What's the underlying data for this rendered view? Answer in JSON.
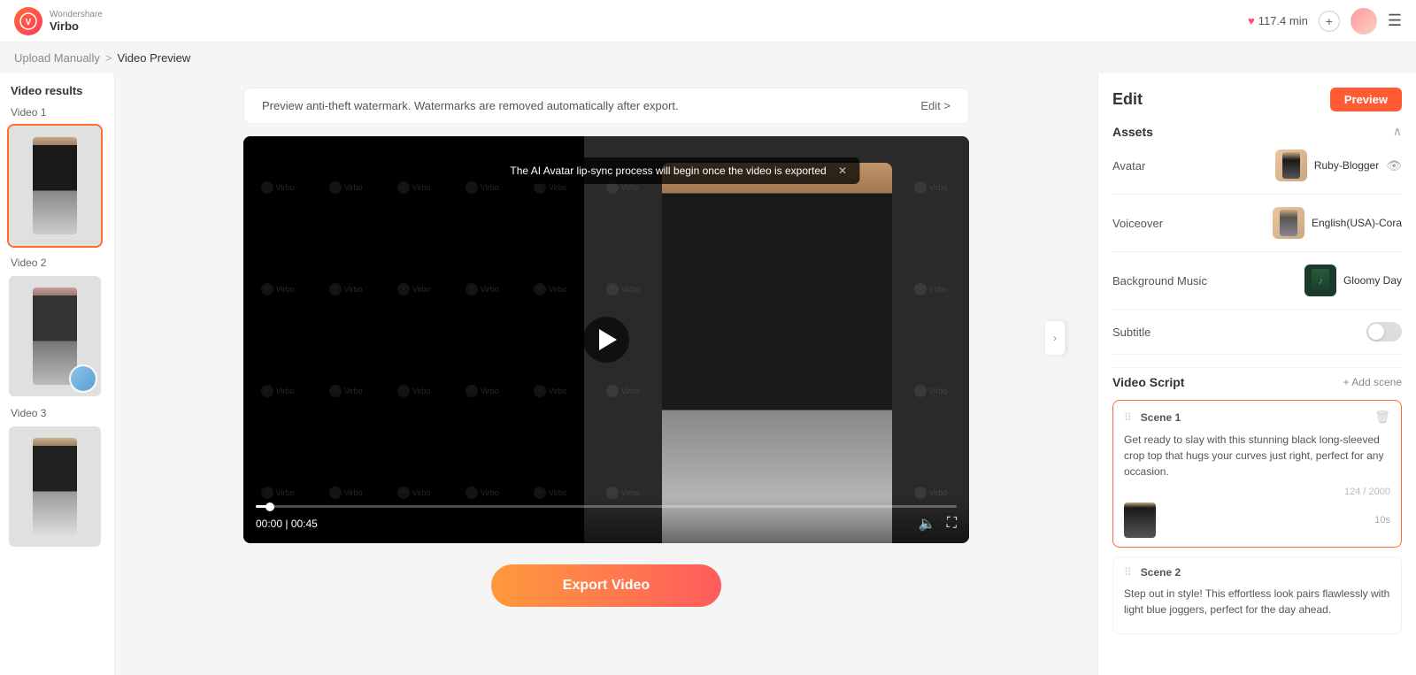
{
  "app": {
    "logo_letter": "V",
    "logo_name": "Wondershare",
    "app_name": "Virbo"
  },
  "topbar": {
    "credits": "117.4 min",
    "add_label": "+",
    "menu_icon": "☰"
  },
  "breadcrumb": {
    "upload": "Upload Manually",
    "separator": ">",
    "current": "Video Preview"
  },
  "sidebar": {
    "title": "Video results",
    "videos": [
      {
        "label": "Video 1",
        "id": "v1",
        "active": true
      },
      {
        "label": "Video 2",
        "id": "v2",
        "active": false
      },
      {
        "label": "Video 3",
        "id": "v3",
        "active": false
      }
    ]
  },
  "player": {
    "watermark_notice": "Preview anti-theft watermark. Watermarks are removed automatically after export.",
    "edit_link": "Edit >",
    "tooltip": "The AI Avatar lip-sync process will begin once the video is exported",
    "time_current": "00:00",
    "time_total": "00:45",
    "play_label": "Play"
  },
  "export": {
    "button_label": "Export Video"
  },
  "edit_panel": {
    "title": "Edit",
    "preview_btn": "Preview",
    "assets_title": "Assets",
    "avatar_label": "Avatar",
    "avatar_name": "Ruby-Blogger",
    "voiceover_label": "Voiceover",
    "voiceover_name": "English(USA)-Cora",
    "music_label": "Background Music",
    "music_name": "Gloomy Day",
    "subtitle_label": "Subtitle",
    "video_script_title": "Video Script",
    "add_scene_label": "+ Add scene",
    "scenes": [
      {
        "name": "Scene 1",
        "text": "Get ready to slay with this stunning black long-sleeved crop top that hugs your curves just right, perfect for any occasion.",
        "char_count": "124 / 2000",
        "duration": "10s",
        "active": true
      },
      {
        "name": "Scene 2",
        "text": "Step out in style! This effortless look pairs flawlessly with light blue joggers, perfect for the day ahead.",
        "char_count": "",
        "duration": "",
        "active": false
      }
    ]
  }
}
